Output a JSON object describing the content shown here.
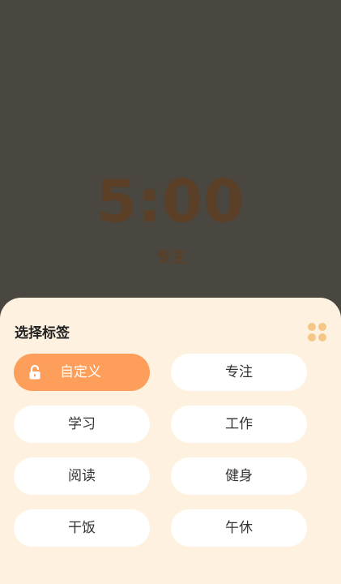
{
  "timer": {
    "time": "5:00",
    "label": "专注"
  },
  "sheet": {
    "title": "选择标签",
    "menu_icon": "grid-icon",
    "tags": [
      {
        "label": "自定义",
        "selected": true,
        "icon": "lock-open-icon"
      },
      {
        "label": "专注",
        "selected": false
      },
      {
        "label": "学习",
        "selected": false
      },
      {
        "label": "工作",
        "selected": false
      },
      {
        "label": "阅读",
        "selected": false
      },
      {
        "label": "健身",
        "selected": false
      },
      {
        "label": "干饭",
        "selected": false
      },
      {
        "label": "午休",
        "selected": false
      }
    ]
  },
  "colors": {
    "background": "#4a4640",
    "timer_text": "#5b3f26",
    "sheet_bg": "#fef1df",
    "accent": "#fd9f5a",
    "icon_accent": "#f6c689"
  }
}
